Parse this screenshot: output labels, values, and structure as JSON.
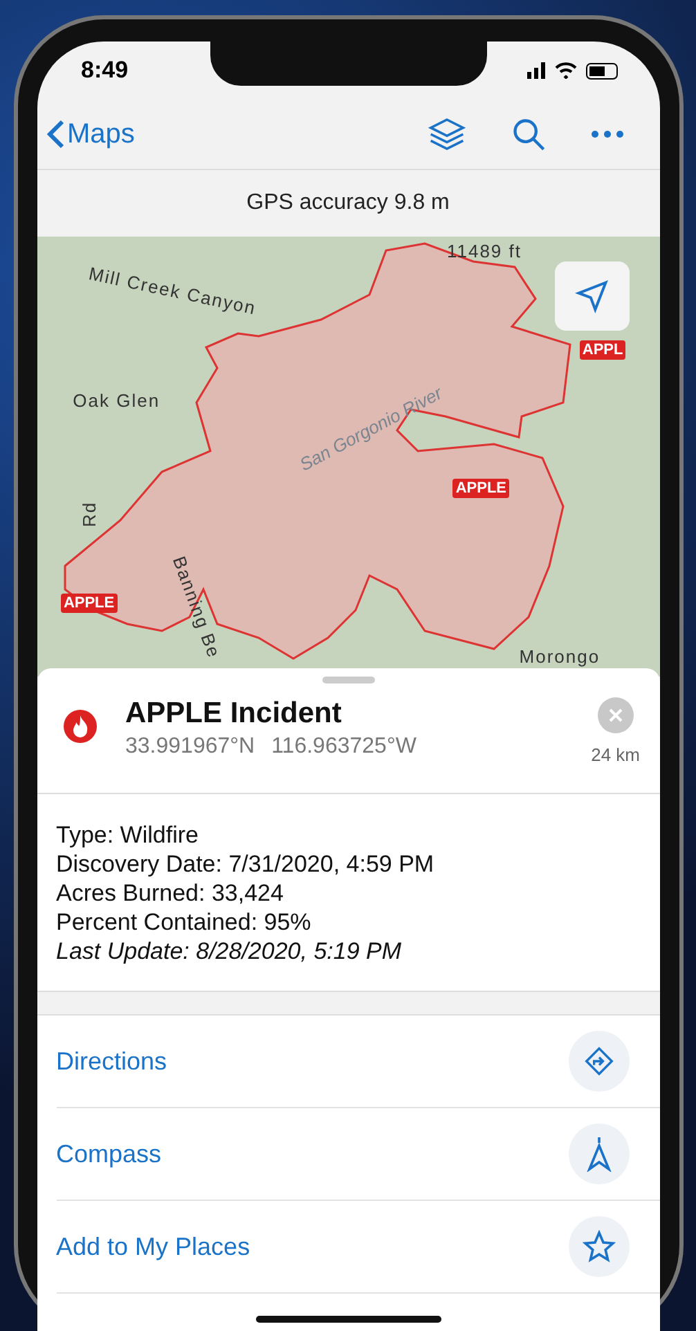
{
  "status_bar": {
    "time": "8:49"
  },
  "nav_bar": {
    "back": "Maps"
  },
  "gps": {
    "text": "GPS accuracy 9.8 m"
  },
  "map": {
    "labels": [
      {
        "kind": "place",
        "text": "11489 ft"
      },
      {
        "kind": "place",
        "text": "Mill Creek Canyon"
      },
      {
        "kind": "fire",
        "text": "APPL"
      },
      {
        "kind": "place",
        "text": "Oak Glen"
      },
      {
        "kind": "river",
        "text": "San Gorgonio River"
      },
      {
        "kind": "fire",
        "text": "APPLE"
      },
      {
        "kind": "place",
        "text": "Rd"
      },
      {
        "kind": "fire",
        "text": "APPLE"
      },
      {
        "kind": "place",
        "text": "Banning Be"
      },
      {
        "kind": "place",
        "text": "Morongo"
      }
    ]
  },
  "incident": {
    "title": "APPLE Incident",
    "latitude": "33.991967°N",
    "longitude": "116.963725°W",
    "distance": "24 km"
  },
  "details": [
    {
      "text": "Type: Wildfire",
      "italic": false
    },
    {
      "text": "Discovery Date: 7/31/2020, 4:59 PM",
      "italic": false
    },
    {
      "text": "Acres Burned: 33,424",
      "italic": false
    },
    {
      "text": "Percent Contained: 95%",
      "italic": false
    },
    {
      "text": "Last Update: 8/28/2020, 5:19 PM",
      "italic": true
    }
  ],
  "actions": [
    {
      "label": "Directions",
      "kind": "directions"
    },
    {
      "label": "Compass",
      "kind": "compass"
    },
    {
      "label": "Add to My Places",
      "kind": "star"
    }
  ]
}
